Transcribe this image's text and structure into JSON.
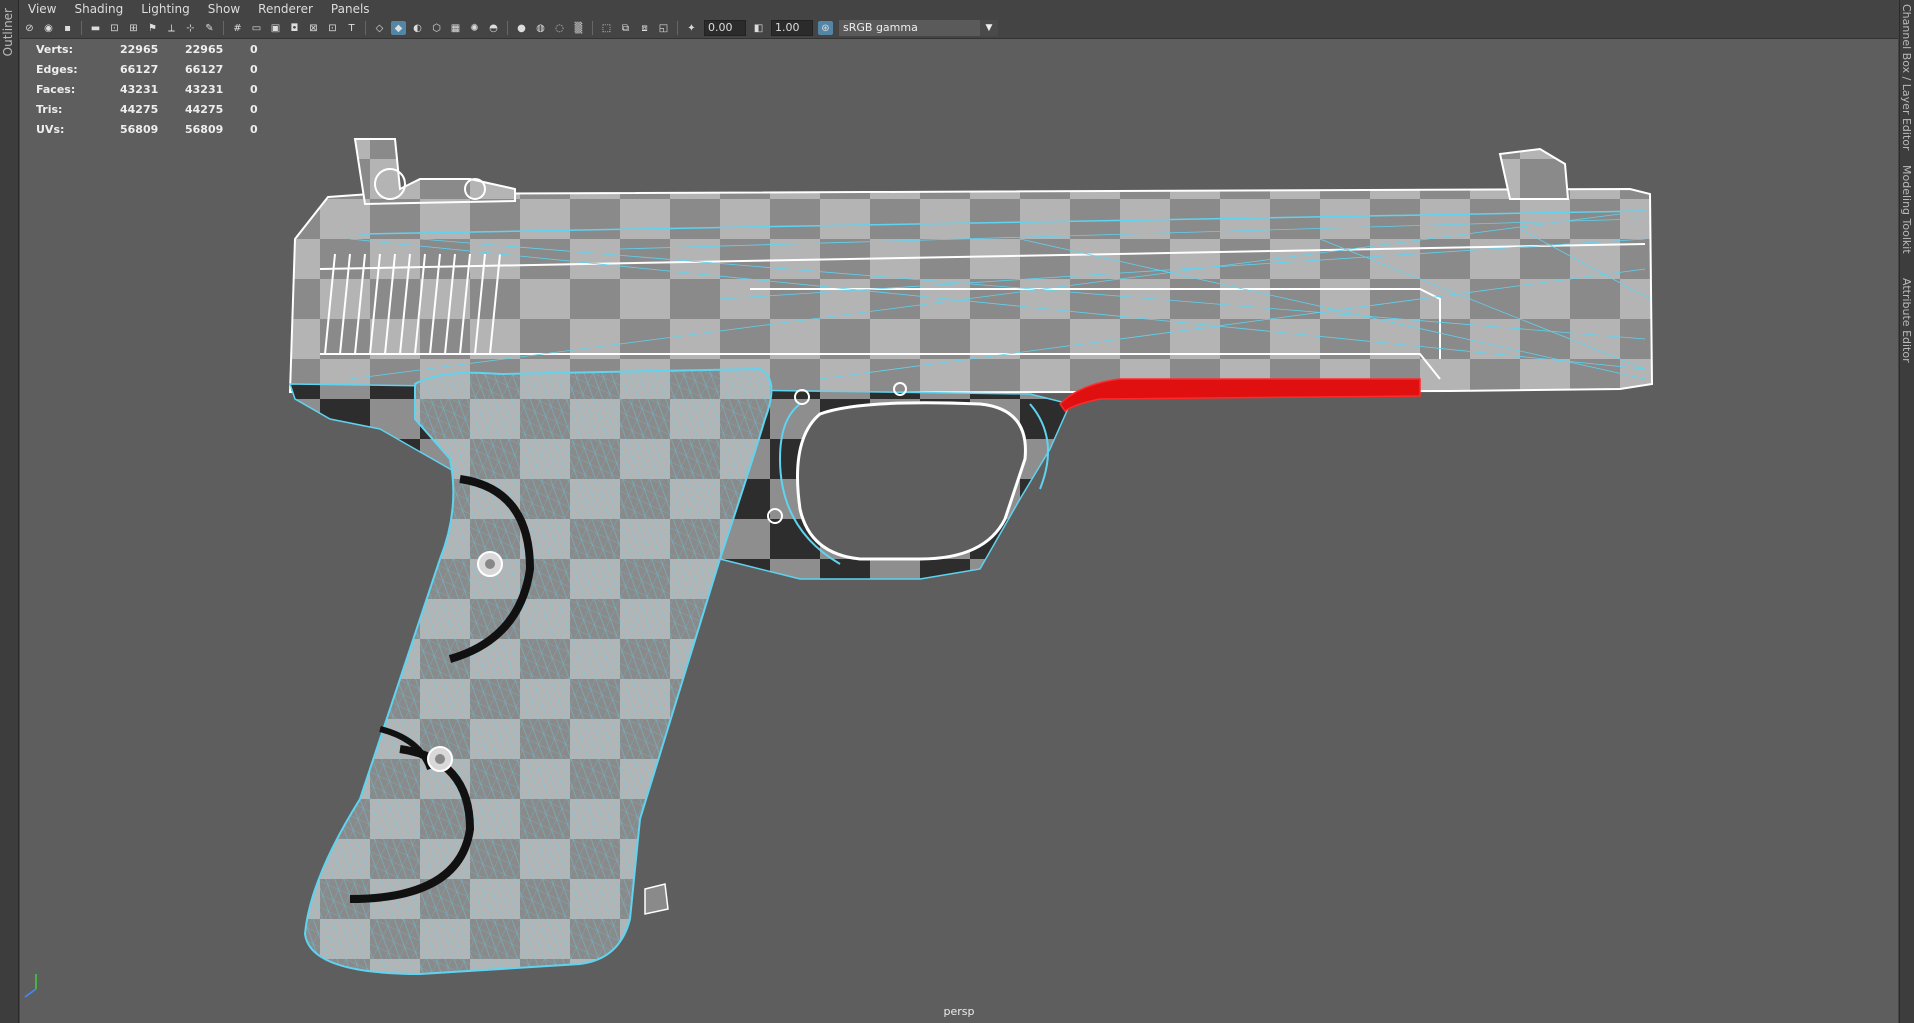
{
  "left_panel": {
    "label": "Outliner"
  },
  "right_panel": {
    "labels": [
      "Channel Box / Layer Editor",
      "Modeling Toolkit",
      "Attribute Editor"
    ]
  },
  "menu": [
    "View",
    "Shading",
    "Lighting",
    "Show",
    "Renderer",
    "Panels"
  ],
  "toolbar": {
    "exposure_value": "0.00",
    "gamma_value": "1.00",
    "color_space": "sRGB gamma"
  },
  "hud": {
    "rows": [
      {
        "label": "Verts:",
        "a": "22965",
        "b": "22965",
        "c": "0"
      },
      {
        "label": "Edges:",
        "a": "66127",
        "b": "66127",
        "c": "0"
      },
      {
        "label": "Faces:",
        "a": "43231",
        "b": "43231",
        "c": "0"
      },
      {
        "label": "Tris:",
        "a": "44275",
        "b": "44275",
        "c": "0"
      },
      {
        "label": "UVs:",
        "a": "56809",
        "b": "56809",
        "c": "0"
      }
    ]
  },
  "camera_label": "persp",
  "colors": {
    "wire": "#5fd3f0",
    "selection": "#e01010",
    "background": "#5e5e5e"
  }
}
